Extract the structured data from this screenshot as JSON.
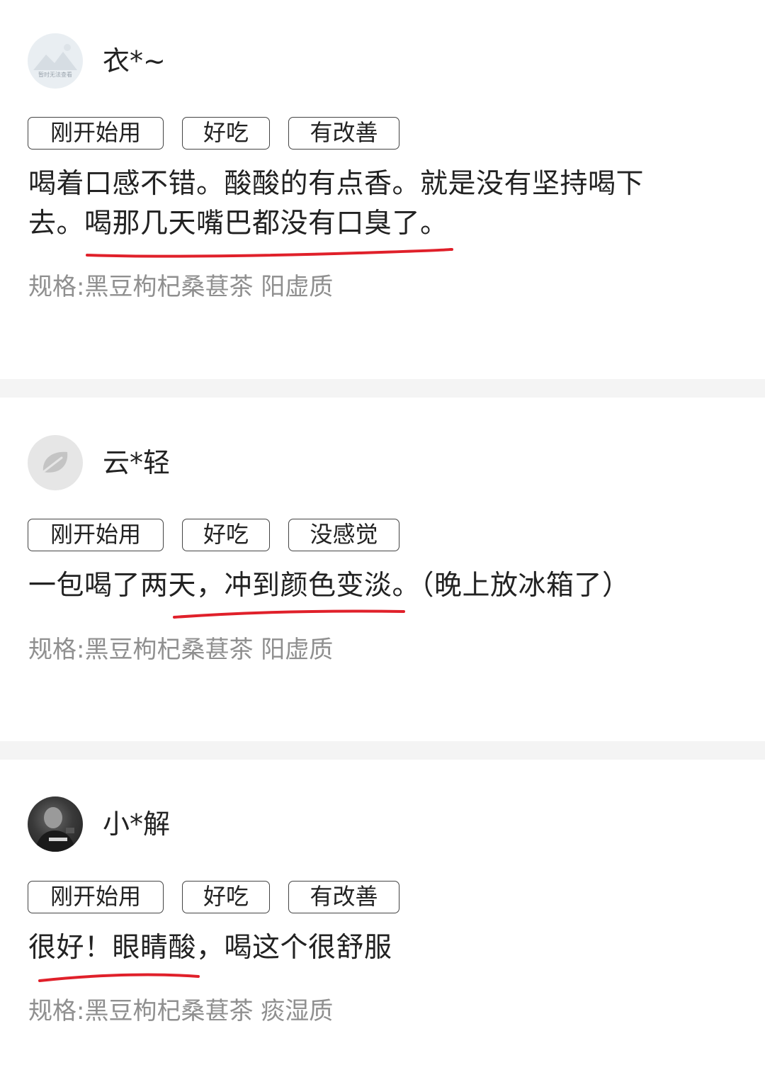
{
  "reviews": [
    {
      "username": "衣*~",
      "avatar_text": "暂时无法查看",
      "tags": [
        "刚开始用",
        "好吃",
        "有改善"
      ],
      "content_line1": "喝着口感不错。酸酸的有点香。就是没有坚持喝下",
      "content_line2": "去。喝那几天嘴巴都没有口臭了。",
      "spec": "规格:黑豆枸杞桑葚茶 阳虚质"
    },
    {
      "username": "云*轻",
      "tags": [
        "刚开始用",
        "好吃",
        "没感觉"
      ],
      "content_line1": "一包喝了两天，冲到颜色变淡。（晚上放冰箱了）",
      "spec": "规格:黑豆枸杞桑葚茶 阳虚质"
    },
    {
      "username": "小*解",
      "tags": [
        "刚开始用",
        "好吃",
        "有改善"
      ],
      "content_line1": "很好！眼睛酸，喝这个很舒服",
      "spec": "规格:黑豆枸杞桑葚茶 痰湿质"
    }
  ],
  "colors": {
    "underline": "#e0202a",
    "tag_border": "#444444",
    "spec": "#8f8f8f",
    "divider": "#f4f4f4"
  },
  "icons": [
    "image-placeholder-icon",
    "leaf-icon"
  ]
}
